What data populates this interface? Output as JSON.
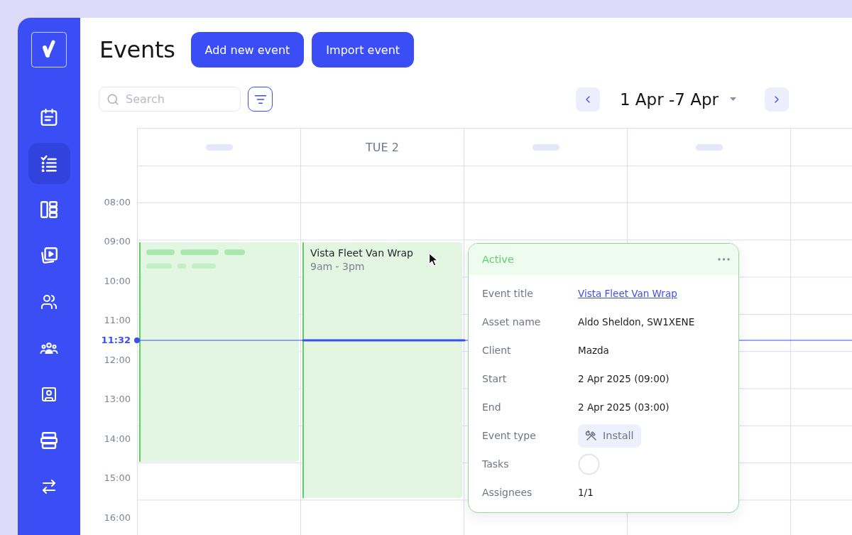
{
  "sidebar": {
    "items": [
      {
        "selected": false
      },
      {
        "selected": true
      },
      {
        "selected": false
      },
      {
        "selected": false
      },
      {
        "selected": false
      },
      {
        "selected": false
      },
      {
        "selected": false
      },
      {
        "selected": false
      },
      {
        "selected": false
      }
    ]
  },
  "header": {
    "title": "Events",
    "buttons": [
      "Add new event",
      "Import event"
    ]
  },
  "toolbar": {
    "search": {
      "placeholder": "Search"
    },
    "date_range": "1 Apr -7 Apr"
  },
  "calendar": {
    "days": [
      {
        "kind": "placeholder",
        "event": {
          "kind": "skeleton"
        }
      },
      {
        "kind": "label",
        "label": "TUE 2",
        "event": {
          "kind": "detail",
          "title": "Vista Fleet Van Wrap",
          "time": "9am - 3pm"
        }
      },
      {
        "kind": "placeholder"
      },
      {
        "kind": "placeholder"
      },
      {
        "kind": "blank"
      }
    ],
    "times": [
      "08:00",
      "09:00",
      "10:00",
      "11:00",
      "12:00",
      "13:00",
      "14:00",
      "15:00",
      "16:00"
    ],
    "current_time": "11:32"
  },
  "popover": {
    "status": "Active",
    "fields": [
      {
        "kind": "link",
        "label": "Event title",
        "value": "Vista Fleet Van Wrap"
      },
      {
        "kind": "text",
        "label": "Asset name",
        "value": "Aldo Sheldon, SW1XENE"
      },
      {
        "kind": "text",
        "label": "Client",
        "value": "Mazda"
      },
      {
        "kind": "text",
        "label": "Start",
        "value": "2 Apr 2025 (09:00)"
      },
      {
        "kind": "text",
        "label": "End",
        "value": "2 Apr 2025 (03:00)"
      },
      {
        "kind": "chip",
        "label": "Event type",
        "value": "Install"
      },
      {
        "kind": "ring",
        "label": "Tasks",
        "level": 0
      },
      {
        "kind": "text",
        "label": "Assignees",
        "value": "1/1"
      }
    ]
  }
}
